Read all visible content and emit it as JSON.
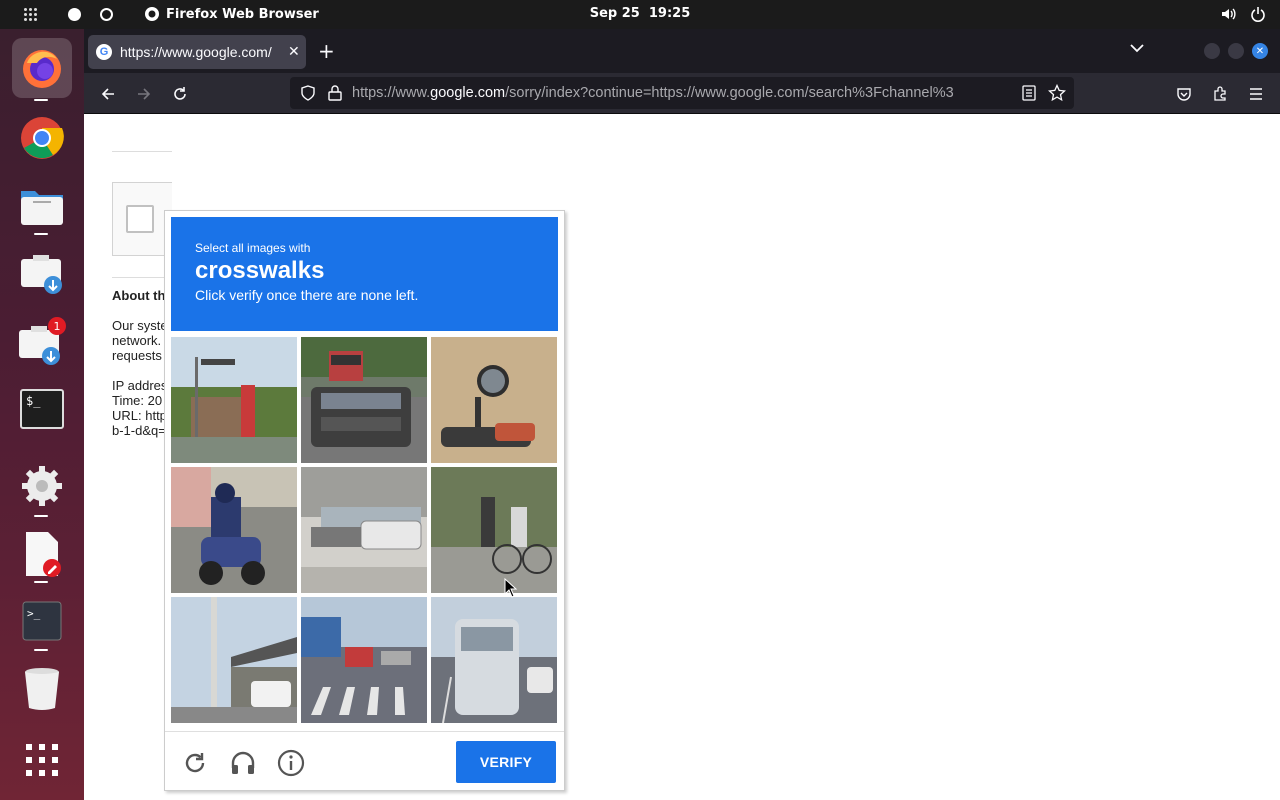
{
  "topbar": {
    "app_name": "Firefox Web Browser",
    "date": "Sep 25",
    "time": "19:25"
  },
  "dock": {
    "items": [
      {
        "name": "firefox",
        "active": true
      },
      {
        "name": "chrome"
      },
      {
        "name": "files"
      },
      {
        "name": "downloads"
      },
      {
        "name": "downloads-2",
        "badge": "1"
      },
      {
        "name": "terminal"
      },
      {
        "name": "settings"
      },
      {
        "name": "text-editor"
      },
      {
        "name": "terminal-2"
      },
      {
        "name": "trash"
      },
      {
        "name": "show-apps"
      }
    ]
  },
  "browser": {
    "tab_title": "https://www.google.com/",
    "url_prefix": "https://www.",
    "url_domain": "google.com",
    "url_rest": "/sorry/index?continue=https://www.google.com/search%3Fchannel%3"
  },
  "page": {
    "about_heading": "About th",
    "lines": [
      "Our syste",
      "network.",
      "requests",
      "",
      "IP addres",
      "Time: 20",
      "URL: http",
      "b-1-d&q="
    ]
  },
  "captcha": {
    "instruction_small": "Select all images with",
    "target": "crosswalks",
    "instruction_sub": "Click verify once there are none left.",
    "verify_label": "VERIFY",
    "tiles": [
      {
        "label": "traffic light street"
      },
      {
        "label": "car and bus"
      },
      {
        "label": "motorcycle mirror"
      },
      {
        "label": "motorcycle rider"
      },
      {
        "label": "parked cars"
      },
      {
        "label": "cyclist"
      },
      {
        "label": "gas station"
      },
      {
        "label": "crosswalk street"
      },
      {
        "label": "van on road"
      }
    ]
  }
}
